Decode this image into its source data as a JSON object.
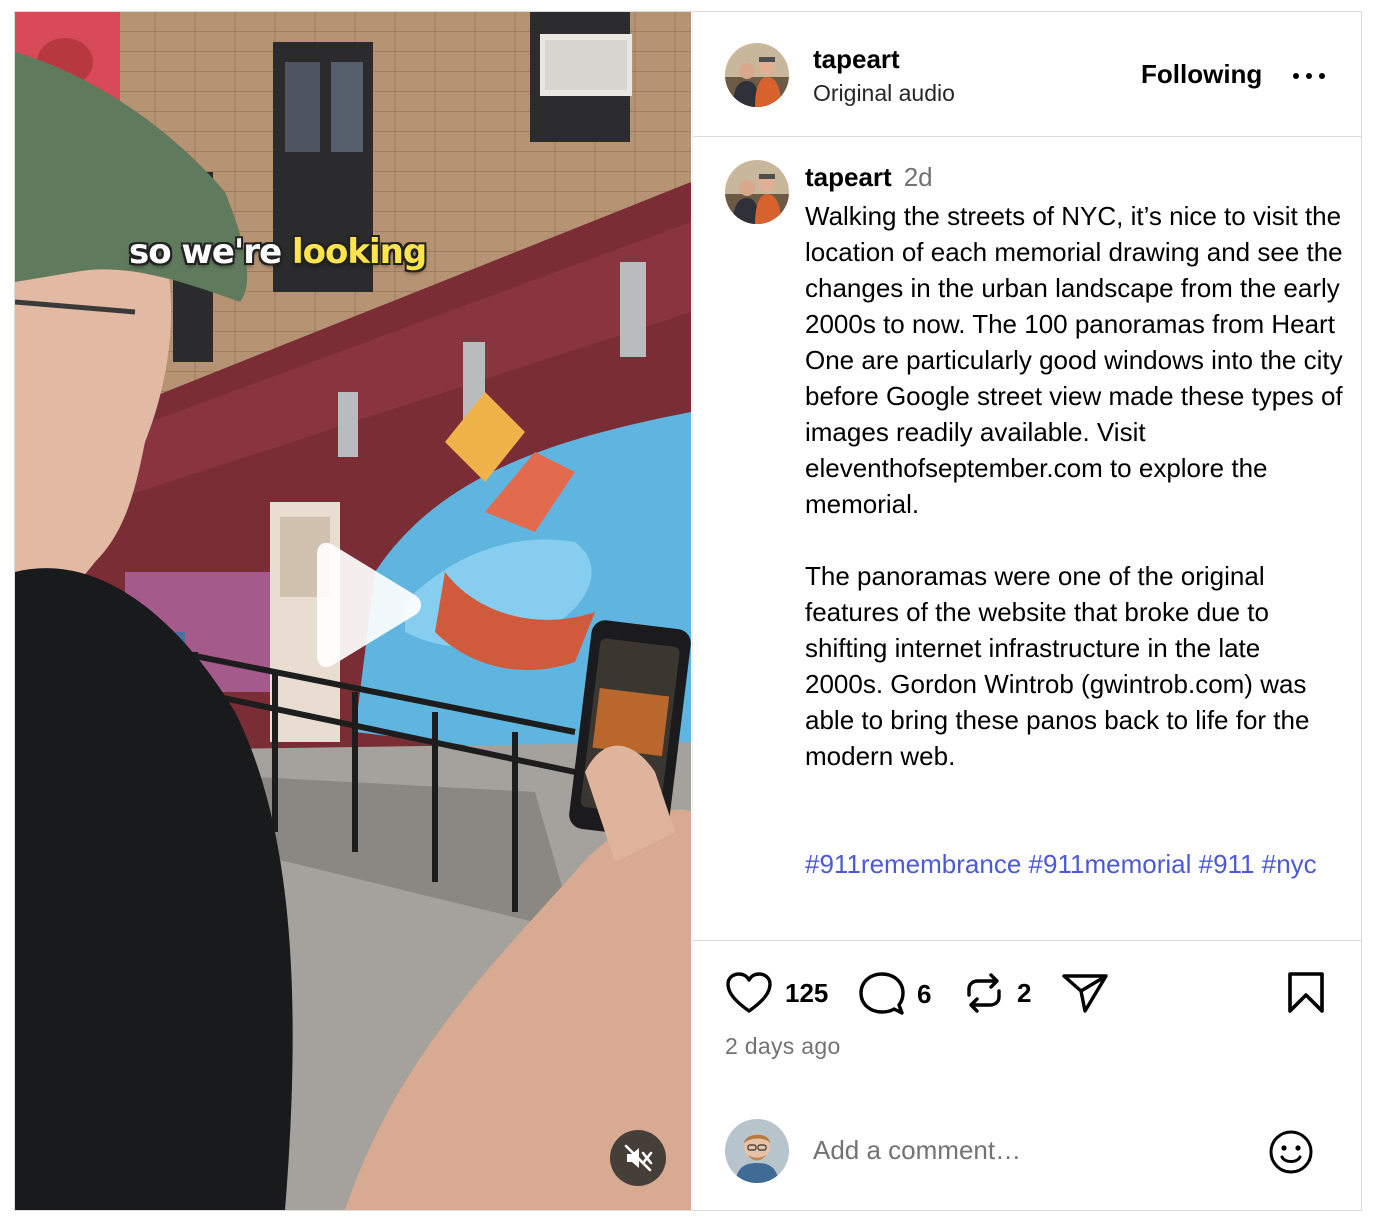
{
  "video": {
    "caption_white": "so we're ",
    "caption_highlight": "looking",
    "play_icon": "play-icon",
    "mute_icon": "speaker-muted-icon"
  },
  "header": {
    "username": "tapeart",
    "audio": "Original audio",
    "follow_status": "Following",
    "more_icon": "more-horizontal-icon"
  },
  "post": {
    "username": "tapeart",
    "time": "2d",
    "caption": "Walking the streets of NYC, it’s nice to visit the location of each memorial drawing and see the changes in the urban landscape from the early 2000s to now. The 100 panoramas from Heart One are particularly good windows into the city before Google street view made these types of images readily available. Visit eleventhofseptember.com to explore the memorial.\n\nThe panoramas were one of the original features of the website that broke due to shifting internet infrastructure in the late 2000s. Gordon Wintrob (gwintrob.com) was able to bring these panos back to life for the modern web.",
    "hashtags": [
      "#911remembrance",
      "#911memorial",
      "#911",
      "#nyc"
    ]
  },
  "actions": {
    "likes": "125",
    "comments": "6",
    "reposts": "2",
    "timestamp": "2 days ago"
  },
  "comment_box": {
    "placeholder": "Add a comment…"
  },
  "colors": {
    "hashtag": "#4c5ad5",
    "caption_highlight": "#ffe44d",
    "muted_text": "#737373"
  }
}
